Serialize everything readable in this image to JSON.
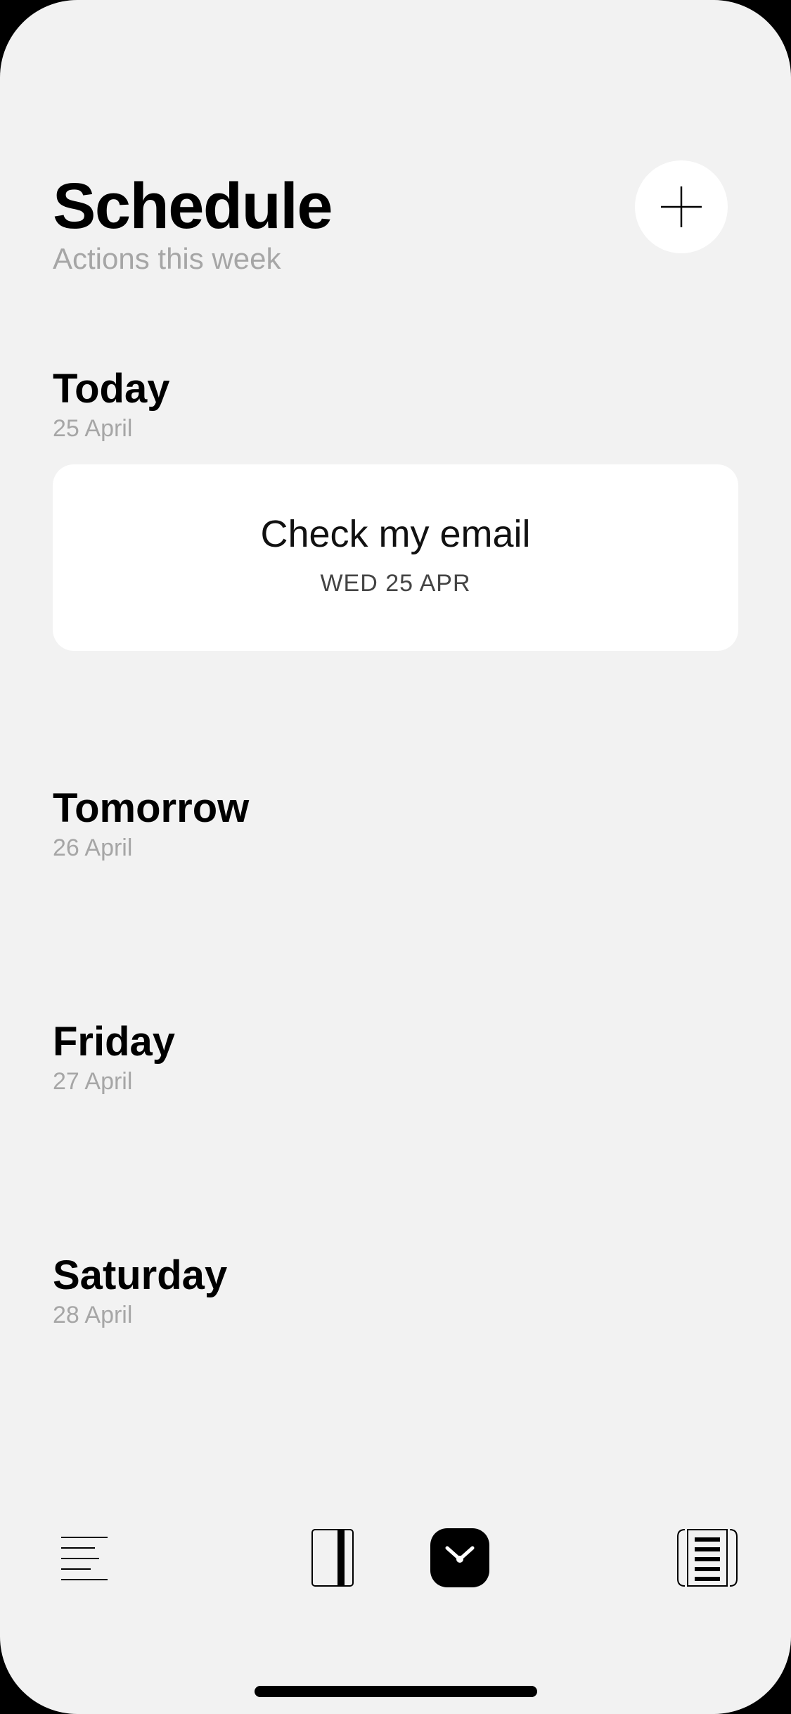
{
  "header": {
    "title": "Schedule",
    "subtitle": "Actions this week",
    "add_icon": "plus-icon"
  },
  "days": [
    {
      "label": "Today",
      "date": "25 April"
    },
    {
      "label": "Tomorrow",
      "date": "26 April"
    },
    {
      "label": "Friday",
      "date": "27 April"
    },
    {
      "label": "Saturday",
      "date": "28 April"
    }
  ],
  "tasks": [
    {
      "title": "Check my email",
      "date": "WED 25 APR"
    }
  ],
  "tab_bar": {
    "tabs": [
      {
        "icon": "list-icon",
        "active": false
      },
      {
        "icon": "notebook-icon",
        "active": false
      },
      {
        "icon": "clock-icon",
        "active": true
      },
      {
        "icon": "document-stack-icon",
        "active": false
      }
    ]
  },
  "colors": {
    "background": "#f2f2f2",
    "card": "#ffffff",
    "secondary_text": "#a6a6a6",
    "active_tab": "#000000"
  }
}
